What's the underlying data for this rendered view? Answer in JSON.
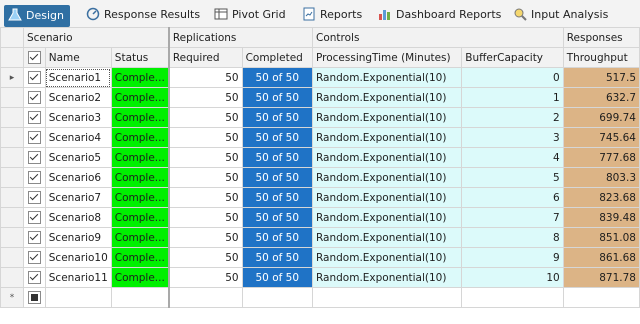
{
  "tabs": [
    {
      "label": "Design",
      "icon": "flask-icon",
      "active": true
    },
    {
      "label": "Response Results",
      "icon": "gauge-icon"
    },
    {
      "label": "Pivot Grid",
      "icon": "pivot-grid-icon"
    },
    {
      "label": "Reports",
      "icon": "report-icon"
    },
    {
      "label": "Dashboard Reports",
      "icon": "bar-chart-icon"
    },
    {
      "label": "Input Analysis",
      "icon": "input-analysis-icon"
    }
  ],
  "bands": {
    "scenario": "Scenario",
    "replications": "Replications",
    "controls": "Controls",
    "responses": "Responses"
  },
  "columns": {
    "name": "Name",
    "status": "Status",
    "required": "Required",
    "completed": "Completed",
    "processing_time": "ProcessingTime (Minutes)",
    "buffer_capacity": "BufferCapacity",
    "throughput": "Throughput"
  },
  "rows": [
    {
      "name": "Scenario1",
      "status": "Comple...",
      "required": "50",
      "completed": "50 of 50",
      "processing_time": "Random.Exponential(10)",
      "buffer_capacity": "0",
      "throughput": "517.5"
    },
    {
      "name": "Scenario2",
      "status": "Comple...",
      "required": "50",
      "completed": "50 of 50",
      "processing_time": "Random.Exponential(10)",
      "buffer_capacity": "1",
      "throughput": "632.7"
    },
    {
      "name": "Scenario3",
      "status": "Comple...",
      "required": "50",
      "completed": "50 of 50",
      "processing_time": "Random.Exponential(10)",
      "buffer_capacity": "2",
      "throughput": "699.74"
    },
    {
      "name": "Scenario4",
      "status": "Comple...",
      "required": "50",
      "completed": "50 of 50",
      "processing_time": "Random.Exponential(10)",
      "buffer_capacity": "3",
      "throughput": "745.64"
    },
    {
      "name": "Scenario5",
      "status": "Comple...",
      "required": "50",
      "completed": "50 of 50",
      "processing_time": "Random.Exponential(10)",
      "buffer_capacity": "4",
      "throughput": "777.68"
    },
    {
      "name": "Scenario6",
      "status": "Comple...",
      "required": "50",
      "completed": "50 of 50",
      "processing_time": "Random.Exponential(10)",
      "buffer_capacity": "5",
      "throughput": "803.3"
    },
    {
      "name": "Scenario7",
      "status": "Comple...",
      "required": "50",
      "completed": "50 of 50",
      "processing_time": "Random.Exponential(10)",
      "buffer_capacity": "6",
      "throughput": "823.68"
    },
    {
      "name": "Scenario8",
      "status": "Comple...",
      "required": "50",
      "completed": "50 of 50",
      "processing_time": "Random.Exponential(10)",
      "buffer_capacity": "7",
      "throughput": "839.48"
    },
    {
      "name": "Scenario9",
      "status": "Comple...",
      "required": "50",
      "completed": "50 of 50",
      "processing_time": "Random.Exponential(10)",
      "buffer_capacity": "8",
      "throughput": "851.08"
    },
    {
      "name": "Scenario10",
      "status": "Comple...",
      "required": "50",
      "completed": "50 of 50",
      "processing_time": "Random.Exponential(10)",
      "buffer_capacity": "9",
      "throughput": "861.68"
    },
    {
      "name": "Scenario11",
      "status": "Comple...",
      "required": "50",
      "completed": "50 of 50",
      "processing_time": "Random.Exponential(10)",
      "buffer_capacity": "10",
      "throughput": "871.78"
    }
  ],
  "new_row_marker": "*",
  "current_row_marker": "▸",
  "colors": {
    "status_complete": "#00f000",
    "completed_bar": "#1f73c6",
    "controls_bg": "#dcfafa",
    "responses_bg": "#dcb486",
    "tab_active": "#2f6fa3"
  }
}
